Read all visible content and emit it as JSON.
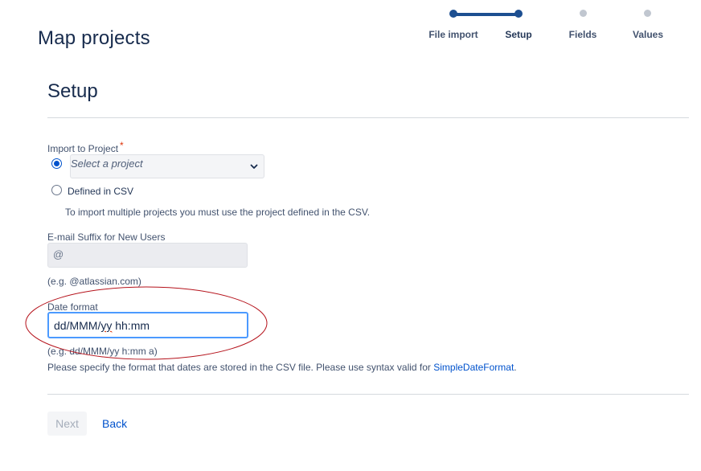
{
  "page": {
    "title": "Map projects"
  },
  "tracker": {
    "steps": [
      {
        "label": "File import",
        "state": "done"
      },
      {
        "label": "Setup",
        "state": "current"
      },
      {
        "label": "Fields",
        "state": "todo"
      },
      {
        "label": "Values",
        "state": "todo"
      }
    ],
    "colors": {
      "done": "#1d4f91",
      "todo": "#c1c7d0"
    }
  },
  "setup": {
    "title": "Setup",
    "import_project": {
      "label": "Import to Project",
      "required_mark": "*",
      "select_placeholder": "Select a project",
      "option_defined_csv": "Defined in CSV",
      "selected": "select",
      "help": "To import multiple projects you must use the project defined in the CSV."
    },
    "email_suffix": {
      "label": "E-mail Suffix for New Users",
      "value": "@",
      "example": "(e.g. @atlassian.com)"
    },
    "date_format": {
      "label": "Date format",
      "value_part1": "dd/MMM/",
      "value_part2": "yy",
      "value_part3": " hh:mm",
      "example": "(e.g. dd/MMM/yy h:mm a)",
      "help_prefix": "Please specify the format that dates are stored in the CSV file. Please use syntax valid for ",
      "help_link": "SimpleDateFormat",
      "help_suffix": "."
    }
  },
  "actions": {
    "next": "Next",
    "back": "Back"
  }
}
